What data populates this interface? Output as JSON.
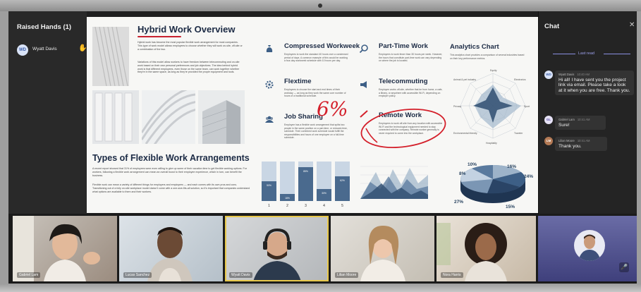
{
  "raised_hands": {
    "title": "Raised Hands (1)",
    "items": [
      {
        "initials": "WD",
        "name": "Wyatt Davis"
      }
    ]
  },
  "slide": {
    "title": "Hybrid Work Overview",
    "intro_1": "Hybrid work has become the most popular flexible work arrangement for most companies. This type of work model allows employees to choose whether they will work on-site, off-site or a combination of the two.",
    "intro_2": "Variations of this model allow workers to have freedom between telecommuting and on-site work based on their own personal preferences and job objectives. The idea behind hybrid work is that different employees, even those on the same team, can work together whether they're in the same space, as long as they're provided the proper equipment and tools.",
    "heading_2": "Types of Flexible Work Arrangements",
    "body_1": "A recent report showed that 31% of employees were even willing to give up some of their vacation time to get flexible working options. For workers, following a flexible work arrangement can mean an overall boost to their employee experience, which in turn, can benefit the business.",
    "body_2": "Flexible work can mean a variety of different things for employers and employees — and each comes with its own pros and cons. Transitioning out of a fully on-site workplace model doesn't come with a one-size-fits-all solution, so it's important that companies understand what options are available to them and their workers.",
    "sections": [
      {
        "title": "Compressed Workweek",
        "text": "Employees to work the standard 40 hours over a condensed period of days. A common example of this would be working a four-day workweek schedule with 10 hours per day."
      },
      {
        "title": "Part-Time Work",
        "text": "Employees to work fewer than 30 hours per week. However, the hours that constitute part-time work can vary depending on where the job is located."
      },
      {
        "title": "Flextime",
        "text": "Employees to choose the start and end times of their workday — as long as they work the same core number of hours of a traditional schedule."
      },
      {
        "title": "Telecommuting",
        "text": "Employee works off-site, whether that be from home, a cafe, a library, or anywhere with accessible Wi-Fi, depending on employer policy."
      },
      {
        "title": "Job Sharing",
        "text": "Employee has a flexible work arrangement that splits two people in the same position on a part-time, or reduced-time, schedule. Their combined work schedule would fulfill the responsibilities and hours of one employee on a full-time schedule."
      },
      {
        "title": "Remote Work",
        "text": "Employees to work off-site from any location with accessible Wi-Fi and the technological equipment needed to stay connected with the company. Remote worker generally is never required to come into the workplace."
      }
    ],
    "analytics": {
      "title": "Analytics Chart",
      "text": "This analytics chart provides a comparison of several industries based on their key performance metrics.",
      "radar_axes": [
        "Equity",
        "Electronics",
        "Sport",
        "Traveler",
        "Hospitality",
        "Environmental friendly",
        "Privacy",
        "Animal & pet industry"
      ]
    },
    "annotation": "6%",
    "pie_labels": [
      "10%",
      "16%",
      "8%",
      "24%",
      "27%",
      "15%"
    ]
  },
  "chart_data": {
    "type": "bar",
    "categories": [
      "1",
      "2",
      "3",
      "4",
      "5"
    ],
    "values": [
      50,
      18,
      85,
      30,
      62
    ],
    "labels": [
      "50%",
      "18%",
      "85%",
      "30%",
      "62%"
    ],
    "ylim": [
      0,
      100
    ]
  },
  "chat": {
    "title": "Chat",
    "last_read": "Last read",
    "messages": [
      {
        "initials": "WD",
        "sender": "Wyatt Davis",
        "time": "10:40 AM",
        "text": "Hi all! I have sent you the project link via email. Please take a look at it when you are free. Thank you."
      },
      {
        "initials": "GL",
        "sender": "Gabriel Lam",
        "time": "10:41 AM",
        "text": "Sure!"
      },
      {
        "initials": "LM",
        "sender": "Lilian Moore",
        "time": "10:41 AM",
        "text": "Thank you."
      }
    ]
  },
  "participants": [
    {
      "name": "Gabriel Lam"
    },
    {
      "name": "Lucas Sanchez"
    },
    {
      "name": "Wyatt Davis",
      "active": true
    },
    {
      "name": "Lilian Moore"
    },
    {
      "name": "Nora Harris"
    }
  ],
  "colors": {
    "accent_red": "#c8202f",
    "navy": "#1b2a44",
    "chat_accent": "#8b8fe0",
    "active_tile": "#e8c84a"
  }
}
